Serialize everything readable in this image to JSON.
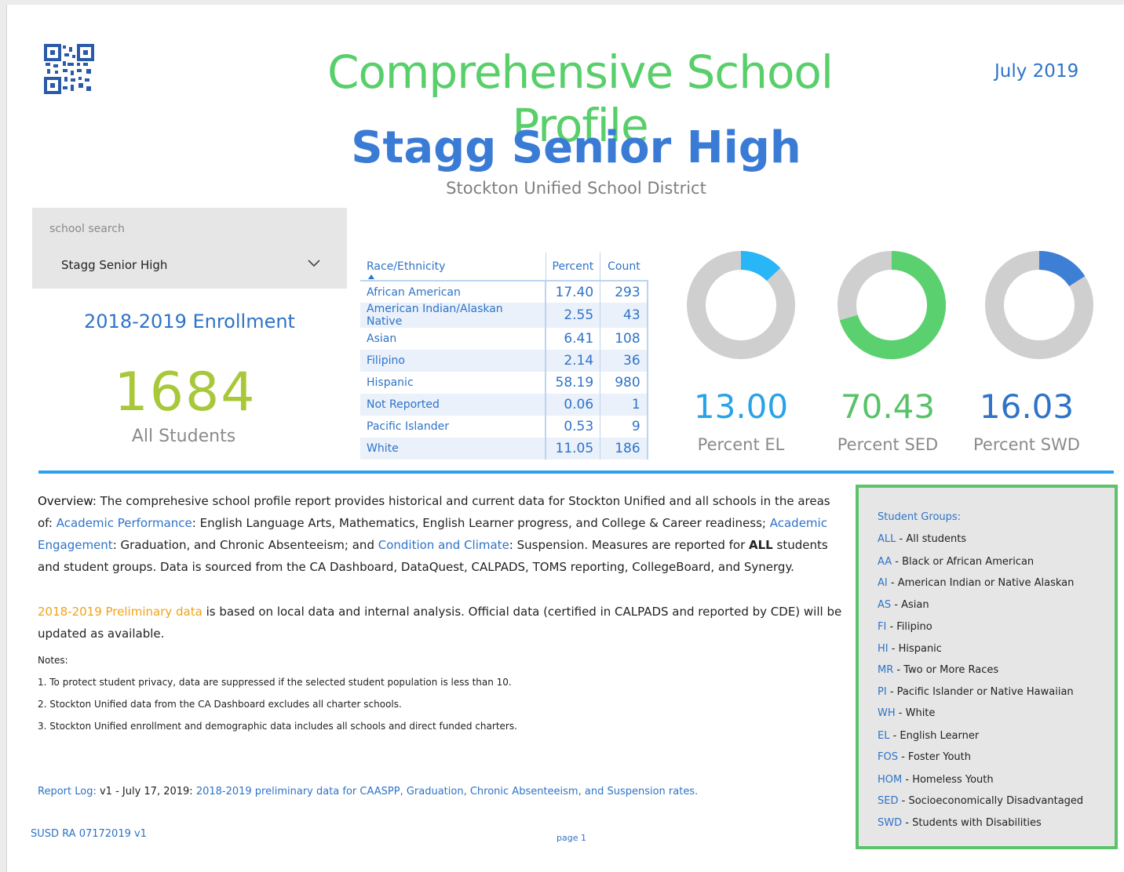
{
  "header": {
    "title": "Comprehensive School Profile",
    "date": "July 2019",
    "school_name": "Stagg Senior High",
    "district": "Stockton Unified School District"
  },
  "search": {
    "label": "school search",
    "value": "Stagg Senior High"
  },
  "enrollment": {
    "title": "2018-2019 Enrollment",
    "count": "1684",
    "label": "All Students"
  },
  "race_table": {
    "headers": [
      "Race/Ethnicity",
      "Percent",
      "Count"
    ],
    "rows": [
      {
        "name": "African American",
        "percent": "17.40",
        "count": "293"
      },
      {
        "name": "American Indian/Alaskan Native",
        "percent": "2.55",
        "count": "43"
      },
      {
        "name": "Asian",
        "percent": "6.41",
        "count": "108"
      },
      {
        "name": "Filipino",
        "percent": "2.14",
        "count": "36"
      },
      {
        "name": "Hispanic",
        "percent": "58.19",
        "count": "980"
      },
      {
        "name": "Not Reported",
        "percent": "0.06",
        "count": "1"
      },
      {
        "name": "Pacific Islander",
        "percent": "0.53",
        "count": "9"
      },
      {
        "name": "White",
        "percent": "11.05",
        "count": "186"
      }
    ]
  },
  "metrics": [
    {
      "value": "13.00",
      "label": "Percent EL",
      "fraction": 0.13,
      "color": "#29b6f6",
      "text_color": "#29a3e6"
    },
    {
      "value": "70.43",
      "label": "Percent SED",
      "fraction": 0.7043,
      "color": "#5bd06e",
      "text_color": "#58c268"
    },
    {
      "value": "16.03",
      "label": "Percent SWD",
      "fraction": 0.1603,
      "color": "#3e7fd6",
      "text_color": "#2e73c8"
    }
  ],
  "overview": {
    "lead": "Overview",
    "text1": ": The comprehesive school profile report provides historical and current data for Stockton Unified and all schools in the areas of: ",
    "ap": "Academic Performance",
    "text2": ": English Language Arts, Mathematics, English Learner progress, and College & Career readiness; ",
    "ae": "Academic Engagement",
    "text3": ": Graduation, and Chronic Absenteeism; and ",
    "cc": "Condition and Climate",
    "text4": ": Suspension. Measures are reported for ",
    "all": "ALL",
    "text5": " students and student groups. Data is sourced from the CA Dashboard, DataQuest, CALPADS, TOMS reporting, CollegeBoard, and Synergy."
  },
  "prelim": {
    "highlight": "2018-2019 Preliminary data",
    "text": " is based on local data and internal analysis. Official data (certified in CALPADS and reported by CDE) will be updated as available."
  },
  "notes": {
    "title": "Notes:",
    "items": [
      "1. To protect student privacy, data are suppressed if the selected student population is less than 10.",
      "2. Stockton Unified data from the CA Dashboard excludes all charter schools.",
      "3. Stockton Unified enrollment and demographic data includes all schools and direct funded charters."
    ]
  },
  "report_log": {
    "label": "Report Log: ",
    "version": "v1 - July 17, 2019: ",
    "text": "2018-2019 preliminary data for CAASPP, Graduation, Chronic Absenteeism, and Suspension rates."
  },
  "footer": {
    "left": "SUSD RA 07172019 v1",
    "page": "page 1"
  },
  "student_groups": {
    "title": "Student Groups:",
    "items": [
      {
        "code": "ALL",
        "desc": " - All students"
      },
      {
        "code": "AA",
        "desc": " - Black or African American"
      },
      {
        "code": "AI",
        "desc": " - American Indian or Native Alaskan"
      },
      {
        "code": "AS",
        "desc": " - Asian"
      },
      {
        "code": "FI",
        "desc": " - Filipino"
      },
      {
        "code": "HI",
        "desc": " - Hispanic"
      },
      {
        "code": "MR",
        "desc": " - Two or More Races"
      },
      {
        "code": "PI",
        "desc": " - Pacific Islander or Native Hawaiian"
      },
      {
        "code": "WH",
        "desc": " - White"
      },
      {
        "code": "EL",
        "desc": " - English Learner"
      },
      {
        "code": "FOS",
        "desc": " - Foster Youth"
      },
      {
        "code": "HOM",
        "desc": " - Homeless Youth"
      },
      {
        "code": "SED",
        "desc": " - Socioeconomically Disadvantaged"
      },
      {
        "code": "SWD",
        "desc": " - Students with Disabilities"
      }
    ]
  }
}
